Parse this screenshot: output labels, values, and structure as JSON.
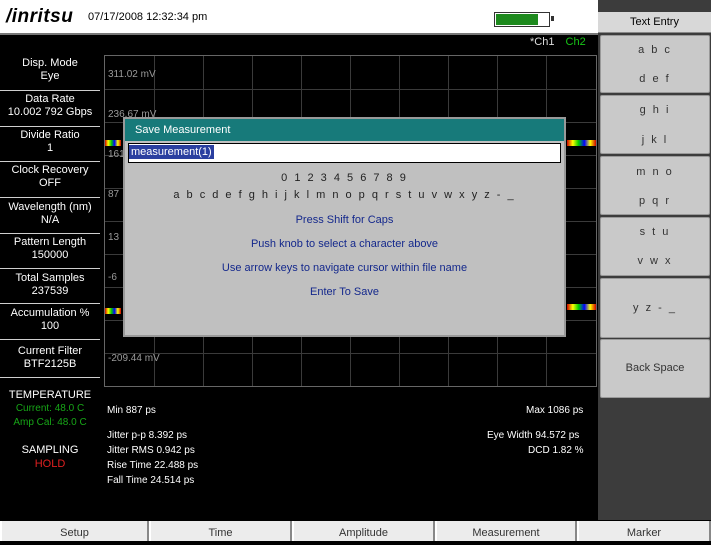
{
  "header": {
    "logo": "/inritsu",
    "datetime": "07/17/2008 12:32:34 pm",
    "channels": [
      "*Ch1",
      "Ch2"
    ]
  },
  "sidebar": {
    "items": [
      {
        "label": "Disp. Mode",
        "value": "Eye"
      },
      {
        "label": "Data Rate",
        "value": "10.002 792 Gbps"
      },
      {
        "label": "Divide Ratio",
        "value": "1"
      },
      {
        "label": "Clock Recovery",
        "value": "OFF"
      },
      {
        "label": "Wavelength (nm)",
        "value": "N/A"
      },
      {
        "label": "Pattern Length",
        "value": "150000"
      },
      {
        "label": "Total Samples",
        "value": "237539"
      },
      {
        "label": "Accumulation %",
        "value": "100"
      },
      {
        "label": "Current Filter",
        "value": "BTF2125B"
      }
    ],
    "temperature": {
      "title": "TEMPERATURE",
      "current": "Current: 48.0 C",
      "amp_cal": "Amp Cal: 48.0 C"
    },
    "sampling": {
      "title": "SAMPLING",
      "value": "HOLD"
    }
  },
  "plot": {
    "y_labels": [
      "311.02 mV",
      "236.67 mV",
      "161",
      "87",
      "13",
      "-6",
      "-209.44 mV"
    ]
  },
  "stats": {
    "min": "Min 887 ps",
    "max": "Max 1086 ps",
    "jitter_pp": "Jitter p-p 8.392 ps",
    "jitter_rms": "Jitter RMS 0.942 ps",
    "rise_time": "Rise Time 22.488 ps",
    "fall_time": "Fall Time 24.514 ps",
    "eye_width": "Eye Width 94.572 ps",
    "dcd": "DCD 1.82 %"
  },
  "softkeys": {
    "title": "Text Entry",
    "keys": [
      {
        "line1": "a b c",
        "line2": "d e f"
      },
      {
        "line1": "g h i",
        "line2": "j k l"
      },
      {
        "line1": "m n o",
        "line2": "p q r"
      },
      {
        "line1": "s t u",
        "line2": "v w x"
      },
      {
        "line1": "y z - _",
        "line2": ""
      },
      {
        "line1": "Back Space",
        "line2": ""
      }
    ]
  },
  "bottom_menu": [
    "Setup",
    "Time",
    "Amplitude",
    "Measurement",
    "Marker"
  ],
  "dialog": {
    "title": "Save Measurement",
    "filename": "measurement(1)",
    "digits": "0 1 2 3 4 5 6 7 8 9",
    "letters": "a b c d e f g h i j k l m n o p q r s t u v w x y z - _",
    "hint_shift": "Press Shift for Caps",
    "hint_knob": "Push knob to select a character above",
    "hint_arrows": "Use arrow keys to navigate cursor within file name",
    "hint_enter": "Enter To Save"
  }
}
